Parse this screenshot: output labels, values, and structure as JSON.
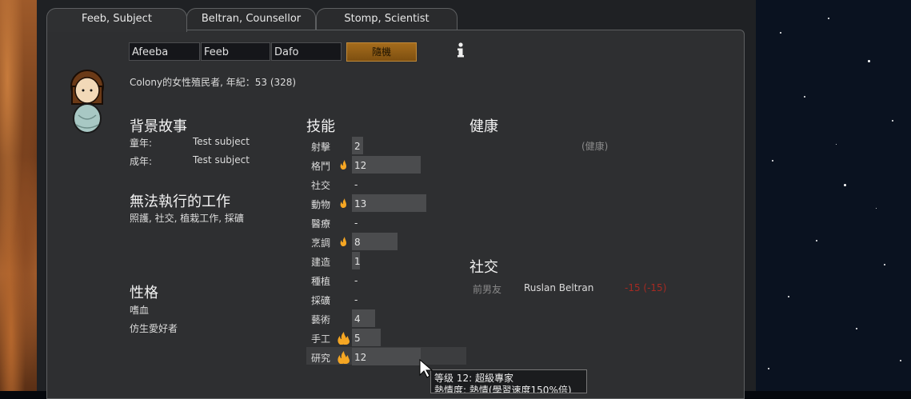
{
  "tabs": [
    "Feeb, Subject",
    "Beltran, Counsellor",
    "Stomp, Scientist"
  ],
  "name_fields": [
    "Afeeba",
    "Feeb",
    "Dafo"
  ],
  "random_button": "隨機",
  "description": "Colony的女性殖民者, 年紀：53 (328)",
  "backstory": {
    "heading": "背景故事",
    "rows": [
      {
        "label": "童年:",
        "value": "Test subject"
      },
      {
        "label": "成年:",
        "value": "Test subject"
      }
    ]
  },
  "incapable": {
    "heading": "無法執行的工作",
    "text": "照護, 社交, 植栽工作, 採礦"
  },
  "traits": {
    "heading": "性格",
    "items": [
      "嗜血",
      "仿生愛好者"
    ]
  },
  "skills": {
    "heading": "技能",
    "rows": [
      {
        "name": "射擊",
        "value": "2",
        "passion": 0,
        "level": 2
      },
      {
        "name": "格鬥",
        "value": "12",
        "passion": 1,
        "level": 12
      },
      {
        "name": "社交",
        "value": "-",
        "passion": 0,
        "level": 0
      },
      {
        "name": "動物",
        "value": "13",
        "passion": 1,
        "level": 13
      },
      {
        "name": "醫療",
        "value": "-",
        "passion": 0,
        "level": 0
      },
      {
        "name": "烹調",
        "value": "8",
        "passion": 1,
        "level": 8
      },
      {
        "name": "建造",
        "value": "1",
        "passion": 0,
        "level": 1
      },
      {
        "name": "種植",
        "value": "-",
        "passion": 0,
        "level": 0
      },
      {
        "name": "採礦",
        "value": "-",
        "passion": 0,
        "level": 0
      },
      {
        "name": "藝術",
        "value": "4",
        "passion": 0,
        "level": 4
      },
      {
        "name": "手工",
        "value": "5",
        "passion": 2,
        "level": 5
      },
      {
        "name": "研究",
        "value": "12",
        "passion": 2,
        "level": 12
      }
    ],
    "max_level": 20
  },
  "health": {
    "heading": "健康",
    "status": "(健康)"
  },
  "social": {
    "heading": "社交",
    "relation": "前男友",
    "person": "Ruslan Beltran",
    "opinion": "-15 (-15)"
  },
  "tooltip": {
    "line1": "等级 12: 超級專家",
    "line2": "熱情度: 熱情(學習速度150%倍)"
  },
  "colors": {
    "accent": "#a56c1c",
    "opinion_negative": "#c2291f",
    "flame": "#f5a623"
  },
  "icons": [
    "info-icon",
    "flame-icon",
    "pawn-avatar",
    "mouse-cursor-icon"
  ]
}
